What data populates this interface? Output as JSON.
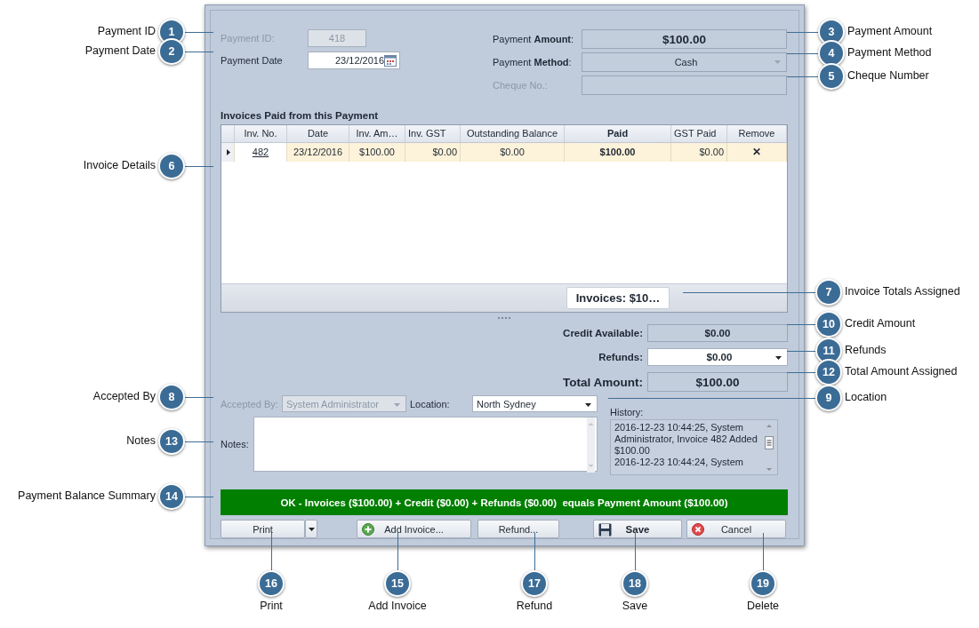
{
  "dialog": {
    "payment_id": {
      "label": "Payment ID:",
      "value": "418",
      "disabled": true
    },
    "payment_date": {
      "label": "Payment Date",
      "value": "23/12/2016"
    },
    "payment_amount": {
      "label": "Payment **Amount**:",
      "value": "$100.00"
    },
    "payment_method": {
      "label": "Payment **Method**:",
      "value": "Cash"
    },
    "cheque_no": {
      "label": "Cheque No.:",
      "disabled": true
    },
    "invoices": {
      "title": "Invoices Paid from this Payment",
      "columns": [
        "Inv. No.",
        "Date",
        "Inv. Am…",
        "Inv. GST",
        "Outstanding Balance",
        "Paid",
        "GST Paid",
        "Remove"
      ],
      "rows": [
        {
          "selected": true,
          "cells": [
            "482",
            "23/12/2016",
            "$100.00",
            "$0.00",
            "$0.00",
            "$100.00",
            "$0.00",
            "✕"
          ]
        }
      ],
      "total": "Invoices:  $10…"
    },
    "credit_available": {
      "label": "Credit Available:",
      "value": "$0.00"
    },
    "refunds": {
      "label": "Refunds:",
      "value": "$0.00"
    },
    "total_amount": {
      "label": "Total Amount:",
      "value": "$100.00"
    },
    "accepted_by": {
      "label": "Accepted By:",
      "value": "System Administrator",
      "disabled": true
    },
    "location": {
      "label": "Location:",
      "value": "North Sydney"
    },
    "history": {
      "label": "History:",
      "entries": [
        "2016-12-23 10:44:25, System Administrator, Invoice 482 Added $100.00",
        "2016-12-23 10:44:24, System"
      ]
    },
    "notes": {
      "label": "Notes:"
    },
    "summary": {
      "text": "OK - Invoices ($100.00) + Credit ($0.00) + Refunds ($0.00)  equals Payment Amount ($100.00)"
    },
    "buttons": [
      {
        "label": "Print",
        "kind": "split"
      },
      {
        "label": "Add Invoice...",
        "kind": "add"
      },
      {
        "label": "Refund...",
        "kind": "plain"
      },
      {
        "label": "Save",
        "kind": "save"
      },
      {
        "label": "Cancel",
        "kind": "cancel"
      }
    ]
  },
  "callouts": [
    {
      "number": "1",
      "label": "Payment ID"
    },
    {
      "number": "2",
      "label": "Payment Date"
    },
    {
      "number": "3",
      "label": "Payment Amount"
    },
    {
      "number": "4",
      "label": "Payment Method"
    },
    {
      "number": "5",
      "label": "Cheque Number"
    },
    {
      "number": "6",
      "label": "Invoice Details"
    },
    {
      "number": "7",
      "label": "Invoice Totals Assigned"
    },
    {
      "number": "10",
      "label": "Credit Amount"
    },
    {
      "number": "11",
      "label": "Refunds"
    },
    {
      "number": "12",
      "label": "Total Amount Assigned"
    },
    {
      "number": "8",
      "label": "Accepted By"
    },
    {
      "number": "9",
      "label": "Location"
    },
    {
      "number": "13",
      "label": "Notes"
    },
    {
      "number": "14",
      "label": "Payment Balance Summary"
    },
    {
      "number": "16",
      "label": "Print"
    },
    {
      "number": "15",
      "label": "Add Invoice"
    },
    {
      "number": "17",
      "label": "Refund"
    },
    {
      "number": "18",
      "label": "Save"
    },
    {
      "number": "19",
      "label": "Delete"
    }
  ]
}
